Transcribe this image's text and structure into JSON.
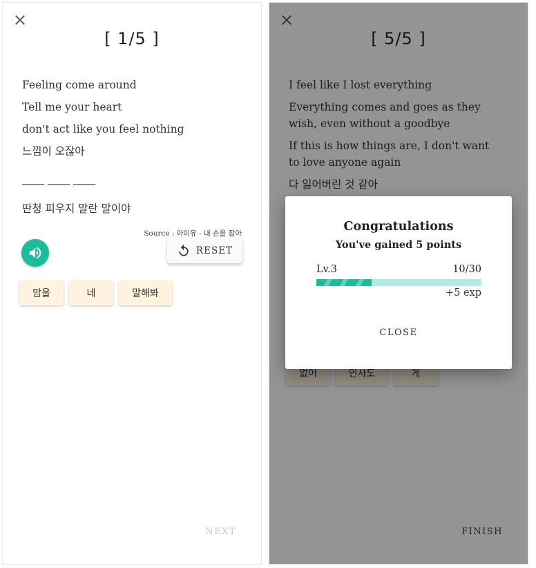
{
  "left_screen": {
    "counter": "[ 1/5 ]",
    "lines": [
      "Feeling come around",
      "Tell me your heart",
      "don't act like you feel nothing"
    ],
    "korean_line_1": "느낌이 오잖아",
    "blanks": "____ ____ ____",
    "korean_line_2": "딴청 피우지 말란 말이야",
    "source": "Source : 아이유 - 내 손을 잡아",
    "reset_label": "RESET",
    "chips": [
      "맘을",
      "네",
      "말해봐"
    ],
    "next_label": "NEXT"
  },
  "right_screen": {
    "counter": "[ 5/5 ]",
    "lines": [
      "I feel like I lost everything",
      "Everything comes and goes as they wish, even without a goodbye",
      "If this is how things are, I don't want to love anyone again"
    ],
    "korean_line": "다 잃어버린 것 같아",
    "chips": [
      "없어",
      "인사도",
      "게"
    ],
    "finish_label": "FINISH"
  },
  "dialog": {
    "title": "Congratulations",
    "subtitle": "You've gained 5 points",
    "level": "Lv.3",
    "exp_text": "10/30",
    "exp_fraction": 0.3333,
    "gain": "+5 exp",
    "close_label": "CLOSE"
  },
  "colors": {
    "accent": "#1abc9c",
    "chip_bg": "#fff3e0",
    "progress_track": "#b2ebdf"
  },
  "icons": [
    "close-icon",
    "volume-icon",
    "reset-icon"
  ]
}
